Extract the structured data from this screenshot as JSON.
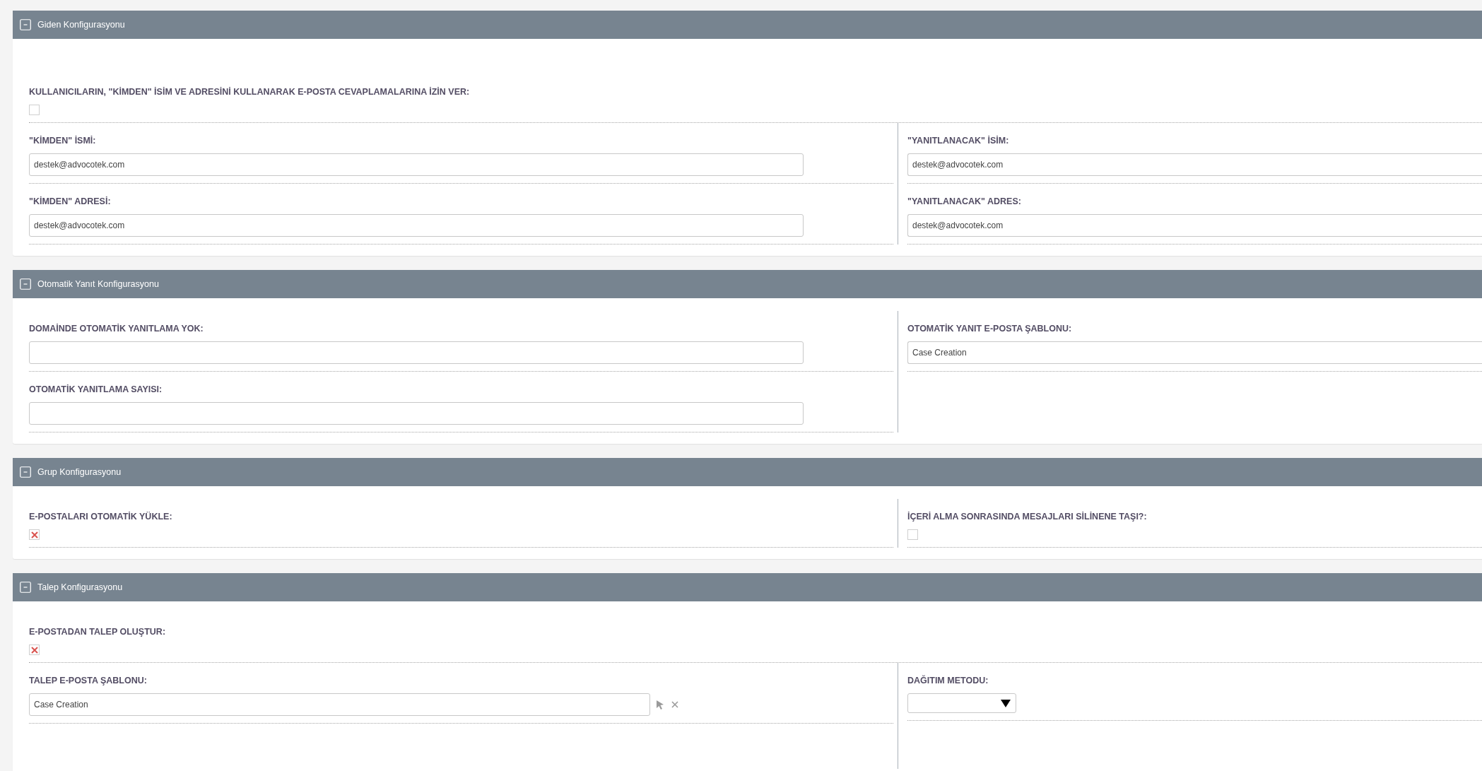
{
  "sections": [
    {
      "title": "Giden Konfigurasyonu",
      "expanded": true,
      "rows": [
        {
          "cells": [
            {
              "label": "KULLANICILARIN, \"KİMDEN\" İSİM VE ADRESİNİ KULLANARAK E-POSTA CEVAPLAMALARINA İZİN VER:",
              "kind": "checkbox",
              "checked": false
            }
          ],
          "kind": "wide"
        },
        {
          "cells": [
            {
              "label": "\"KİMDEN\" İSMİ:",
              "kind": "text",
              "value": "destek@advocotek.com"
            },
            {
              "label": "\"YANITLANACAK\" İSİM:",
              "kind": "text",
              "value": "destek@advocotek.com"
            }
          ]
        },
        {
          "cells": [
            {
              "label": "\"KİMDEN\" ADRESİ:",
              "kind": "text",
              "value": "destek@advocotek.com"
            },
            {
              "label": "\"YANITLANACAK\" ADRES:",
              "kind": "text",
              "value": "destek@advocotek.com"
            }
          ]
        }
      ]
    },
    {
      "title": "Otomatik Yanıt Konfigurasyonu",
      "expanded": true,
      "rows": [
        {
          "cells": [
            {
              "label": "DOMAİNDE OTOMATİK YANITLAMA YOK:",
              "kind": "text"
            },
            {
              "label": "OTOMATİK YANIT E-POSTA ŞABLONU:",
              "kind": "text",
              "value": "Case Creation"
            }
          ]
        },
        {
          "cells": [
            {
              "label": "OTOMATİK YANITLAMA SAYISI:",
              "kind": "text"
            }
          ]
        }
      ]
    },
    {
      "title": "Grup Konfigurasyonu",
      "expanded": true,
      "rows": [
        {
          "cells": [
            {
              "label": "E-POSTALARI OTOMATİK YÜKLE:",
              "kind": "checkbox",
              "checked": true
            },
            {
              "label": "İÇERİ ALMA SONRASINDA MESAJLARI SİLİNENE TAŞI?:",
              "kind": "checkbox",
              "checked": false
            }
          ]
        }
      ]
    },
    {
      "title": "Talep Konfigurasyonu",
      "expanded": true,
      "rows": [
        {
          "cells": [
            {
              "label": "E-POSTADAN TALEP OLUŞTUR:",
              "kind": "checkbox",
              "checked": true
            }
          ],
          "kind": "wide"
        },
        {
          "cells": [
            {
              "label": "TALEP E-POSTA ŞABLONU:",
              "kind": "relate",
              "value": "Case Creation"
            },
            {
              "label": "DAĞITIM METODU:",
              "kind": "select"
            }
          ]
        }
      ]
    }
  ]
}
